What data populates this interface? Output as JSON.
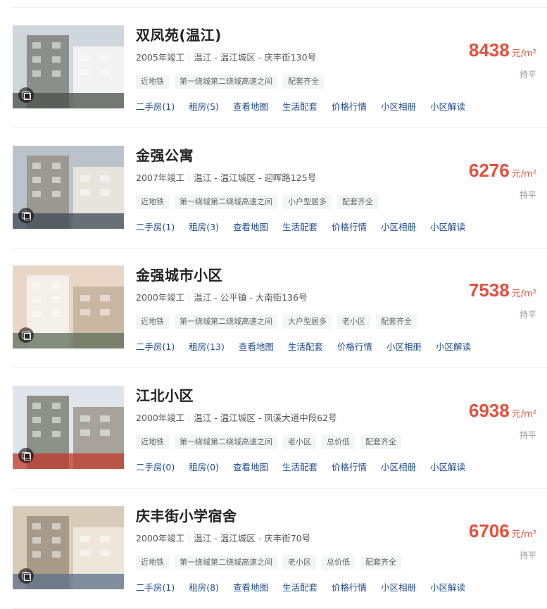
{
  "communities": [
    {
      "name": "双凤苑(温江)",
      "year": "2005年竣工",
      "location": "温江 - 温江城区 - 庆丰街130号",
      "tags": [
        "近地铁",
        "第一绕城第二绕城高速之间",
        "配套齐全"
      ],
      "links": [
        "二手房(1)",
        "租房(5)",
        "查看地图",
        "生活配套",
        "价格行情",
        "小区相册",
        "小区解读"
      ],
      "price": "8438",
      "price_unit": "元/m²",
      "trend": "持平",
      "thumb_palette": [
        "#cfd6dc",
        "#8b8f8c",
        "#f2f2f2",
        "#4a4f4a"
      ]
    },
    {
      "name": "金强公寓",
      "year": "2007年竣工",
      "location": "温江 - 温江城区 - 迎晖路125号",
      "tags": [
        "近地铁",
        "第一绕城第二绕城高速之间",
        "小户型居多",
        "配套齐全"
      ],
      "links": [
        "二手房(1)",
        "租房(3)",
        "查看地图",
        "生活配套",
        "价格行情",
        "小区相册",
        "小区解读"
      ],
      "price": "6276",
      "price_unit": "元/m²",
      "trend": "持平",
      "thumb_palette": [
        "#b9c3c9",
        "#9c9990",
        "#e7e4dc",
        "#3e4a55"
      ]
    },
    {
      "name": "金强城市小区",
      "year": "2000年竣工",
      "location": "温江 - 公平镇 - 大南街136号",
      "tags": [
        "近地铁",
        "第一绕城第二绕城高速之间",
        "大户型居多",
        "老小区",
        "配套齐全"
      ],
      "links": [
        "二手房(1)",
        "租房(13)",
        "查看地图",
        "生活配套",
        "价格行情",
        "小区相册",
        "小区解读"
      ],
      "price": "7538",
      "price_unit": "元/m²",
      "trend": "持平",
      "thumb_palette": [
        "#e9d6c6",
        "#f3efe9",
        "#c9b6a3",
        "#5f6e5a"
      ]
    },
    {
      "name": "江北小区",
      "year": "2000年竣工",
      "location": "温江 - 温江城区 - 凤溪大道中段62号",
      "tags": [
        "近地铁",
        "第一绕城第二绕城高速之间",
        "老小区",
        "总价低",
        "配套齐全"
      ],
      "links": [
        "二手房(0)",
        "租房(0)",
        "查看地图",
        "生活配套",
        "价格行情",
        "小区相册",
        "小区解读"
      ],
      "price": "6938",
      "price_unit": "元/m²",
      "trend": "持平",
      "thumb_palette": [
        "#dfe5ea",
        "#8d9188",
        "#a7a39a",
        "#c0392b"
      ]
    },
    {
      "name": "庆丰街小学宿舍",
      "year": "2000年竣工",
      "location": "温江 - 温江城区 - 庆丰街70号",
      "tags": [
        "近地铁",
        "第一绕城第二绕城高速之间",
        "老小区",
        "总价低",
        "配套齐全"
      ],
      "links": [
        "二手房(1)",
        "租房(8)",
        "查看地图",
        "生活配套",
        "价格行情",
        "小区相册",
        "小区解读"
      ],
      "price": "6706",
      "price_unit": "元/m²",
      "trend": "持平",
      "thumb_palette": [
        "#d9cbb9",
        "#a79a89",
        "#eee6da",
        "#5b6f88"
      ]
    }
  ],
  "icons": {
    "album": "album-icon"
  },
  "colors": {
    "price": "#e4503c",
    "link": "#1f4b8f",
    "tag_bg": "#f3f5f7"
  }
}
